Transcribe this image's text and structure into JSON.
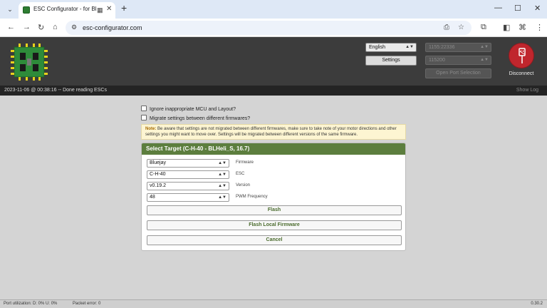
{
  "browser": {
    "tab_title": "ESC Configurator - for Bluej",
    "new_tab_icon": "plus-icon",
    "url": "esc-configurator.com",
    "window_controls": [
      "minimize-icon",
      "maximize-icon",
      "close-icon"
    ]
  },
  "header": {
    "language": "English",
    "baud_port": "1155:22336",
    "baud_rate": "115200",
    "settings_label": "Settings",
    "open_port_label": "Open Port Selection",
    "disconnect_label": "Disconnect"
  },
  "status": {
    "message": "2023-11-06 @ 00:38:16 -- Done reading ESCs",
    "show_log": "Show Log"
  },
  "options": {
    "ignore_mcu": "Ignore inappropriate MCU and Layout?",
    "migrate": "Migrate settings between different firmwares?"
  },
  "note": {
    "label": "Note:",
    "text": "Be aware that settings are not migrated between different firmwares, make sure to take note of your motor directions and other settings you might want to move over. Settings will be migrated between different versions of the same firmware."
  },
  "panel": {
    "title": "Select Target (C-H-40 - BLHeli_S, 16.7)",
    "fields": [
      {
        "value": "Bluejay",
        "label": "Firmware"
      },
      {
        "value": "C-H-40",
        "label": "ESC"
      },
      {
        "value": "v0.19.2",
        "label": "Version"
      },
      {
        "value": "48",
        "label": "PWM Frequency"
      }
    ],
    "buttons": {
      "flash": "Flash",
      "flash_local": "Flash Local Firmware",
      "cancel": "Cancel"
    }
  },
  "footer": {
    "port_util": "Port utilization: D: 0% U: 0%",
    "packet_error": "Packet error: 0",
    "version": "0.30.2"
  },
  "colors": {
    "panel_header": "#5c7e3e",
    "disconnect": "#c0262d",
    "app_header": "#3c3c3c"
  }
}
